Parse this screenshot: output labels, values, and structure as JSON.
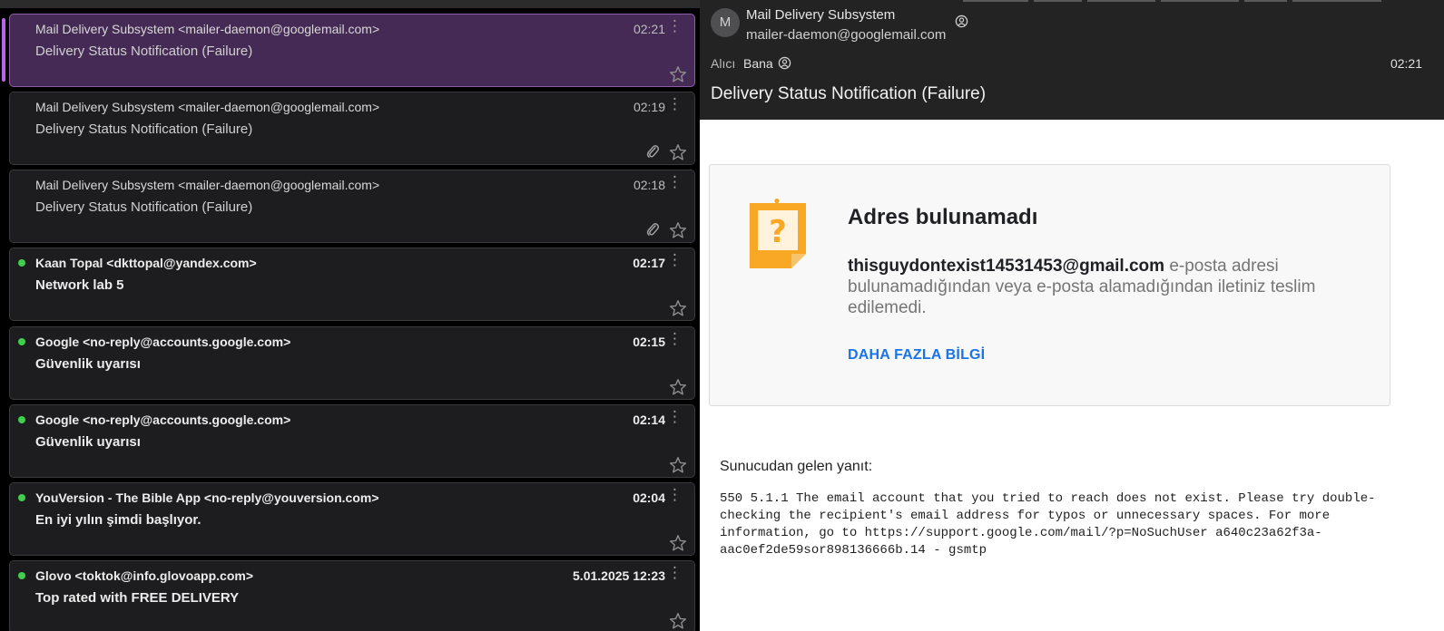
{
  "mail_list": [
    {
      "sender": "Mail Delivery Subsystem <mailer-daemon@googlemail.com>",
      "subject": "Delivery Status Notification (Failure)",
      "time": "02:21",
      "unread": false,
      "selected": true,
      "attachment": false
    },
    {
      "sender": "Mail Delivery Subsystem <mailer-daemon@googlemail.com>",
      "subject": "Delivery Status Notification (Failure)",
      "time": "02:19",
      "unread": false,
      "selected": false,
      "attachment": true
    },
    {
      "sender": "Mail Delivery Subsystem <mailer-daemon@googlemail.com>",
      "subject": "Delivery Status Notification (Failure)",
      "time": "02:18",
      "unread": false,
      "selected": false,
      "attachment": true
    },
    {
      "sender": "Kaan Topal <dkttopal@yandex.com>",
      "subject": "Network lab 5",
      "time": "02:17",
      "unread": true,
      "selected": false,
      "attachment": false
    },
    {
      "sender": "Google <no-reply@accounts.google.com>",
      "subject": "Güvenlik uyarısı",
      "time": "02:15",
      "unread": true,
      "selected": false,
      "attachment": false
    },
    {
      "sender": "Google <no-reply@accounts.google.com>",
      "subject": "Güvenlik uyarısı",
      "time": "02:14",
      "unread": true,
      "selected": false,
      "attachment": false
    },
    {
      "sender": "YouVersion - The Bible App <no-reply@youversion.com>",
      "subject": "En iyi yılın şimdi başlıyor.",
      "time": "02:04",
      "unread": true,
      "selected": false,
      "attachment": false
    },
    {
      "sender": "Glovo <toktok@info.glovoapp.com>",
      "subject": "Top rated with FREE DELIVERY",
      "time": "5.01.2025 12:23",
      "unread": true,
      "selected": false,
      "attachment": false
    }
  ],
  "reader": {
    "avatar_letter": "M",
    "from_name": "Mail Delivery Subsystem",
    "from_email": "mailer-daemon@googlemail.com",
    "to_label": "Alıcı",
    "to_value": "Bana",
    "time": "02:21",
    "subject": "Delivery Status Notification (Failure)"
  },
  "notice": {
    "title": "Adres bulunamadı",
    "email": "thisguydontexist14531453@gmail.com",
    "body": " e-posta adresi bulunamadığından veya e-posta alamadığından iletiniz teslim edilemedi.",
    "more_info": "DAHA FAZLA BİLGİ"
  },
  "server": {
    "label": "Sunucudan gelen yanıt:",
    "response": "550 5.1.1 The email account that you tried to reach does not exist. Please try double-\nchecking the recipient's email address for typos or unnecessary spaces. For more\ninformation, go to https://support.google.com/mail/?p=NoSuchUser a640c23a62f3a-\naac0ef2de59sor898136666b.14 - gsmtp"
  },
  "colors": {
    "selected_bg": "#442a54",
    "unread_dot": "#3ecf4c",
    "link": "#1a73e8",
    "warn_icon": "#f9a825"
  }
}
